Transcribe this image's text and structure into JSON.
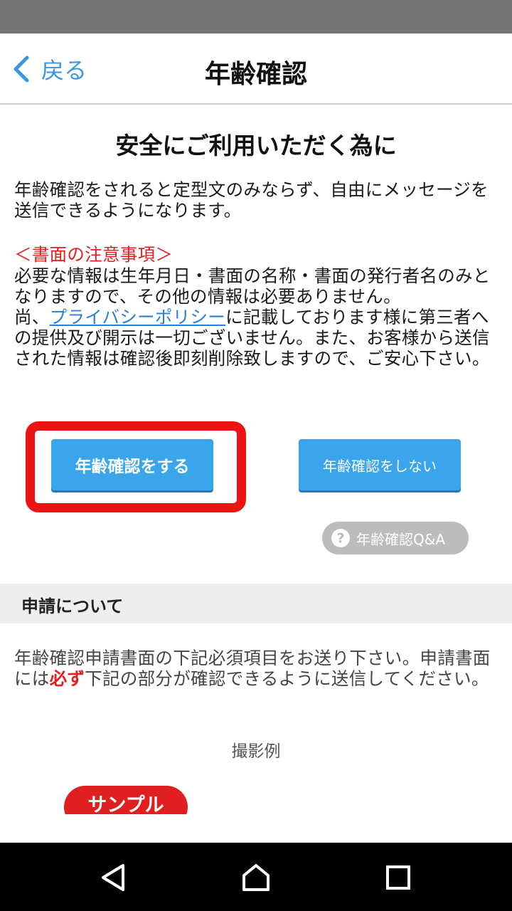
{
  "header": {
    "back_label": "戻る",
    "title": "年齢確認"
  },
  "main": {
    "heading": "安全にご利用いただく為に",
    "intro": "年齢確認をされると定型文のみならず、自由にメッセージを送信できるようになります。",
    "notice_title": "＜書面の注意事項＞",
    "notice_line1": "必要な情報は生年月日・書面の名称・書面の発行者名のみとなりますので、その他の情報は必要ありません。",
    "notice_prefix": "尚、",
    "privacy_link": "プライバシーポリシー",
    "notice_suffix": "に記載しております様に第三者への提供及び開示は一切ございません。また、お客様から送信された情報は確認後即刻削除致しますので、ご安心下さい。",
    "confirm_button": "年齢確認をする",
    "decline_button": "年齢確認をしない",
    "qa_button": "年齢確認Q&A"
  },
  "application": {
    "section_title": "申請について",
    "text_part1": "年齢確認申請書面の下記必須項目をお送り下さい。申請書面には",
    "text_emphasis": "必ず",
    "text_part2": "下記の部分が確認できるように送信してください。",
    "example_label": "撮影例",
    "sample_badge": "サンプル"
  },
  "colors": {
    "accent": "#3aa5ea",
    "link": "#2e7ed6",
    "warning": "#e02020",
    "highlight_frame": "#ec1313"
  },
  "icons": {
    "back": "chevron-left-icon",
    "qa": "question-circle-icon",
    "nav_back": "triangle-back-icon",
    "nav_home": "home-icon",
    "nav_recent": "square-recent-icon"
  }
}
